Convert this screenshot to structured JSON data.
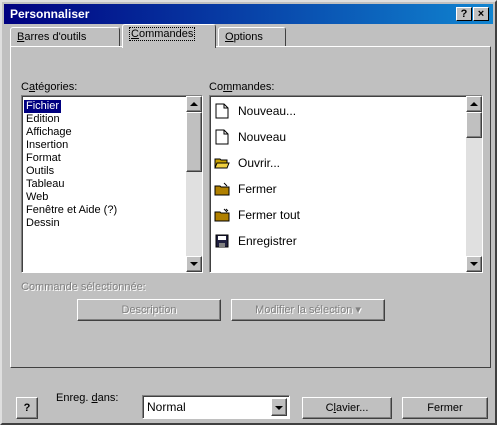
{
  "window": {
    "title": "Personnaliser",
    "help_glyph": "?",
    "close_glyph": "×"
  },
  "tabs": [
    {
      "pre": "",
      "key": "B",
      "post": "arres d'outils"
    },
    {
      "pre": "",
      "key": "C",
      "post": "ommandes"
    },
    {
      "pre": "",
      "key": "O",
      "post": "ptions"
    }
  ],
  "categories": {
    "label_pre": "C",
    "label_key": "a",
    "label_post": "tégories:",
    "items": [
      "Fichier",
      "Edition",
      "Affichage",
      "Insertion",
      "Format",
      "Outils",
      "Tableau",
      "Web",
      "Fenêtre et Aide (?)",
      "Dessin"
    ],
    "selected_index": 0
  },
  "commands": {
    "label_pre": "Co",
    "label_key": "m",
    "label_post": "mandes:",
    "items": [
      {
        "label": "Nouveau...",
        "icon": "new-document-icon"
      },
      {
        "label": "Nouveau",
        "icon": "new-document-icon"
      },
      {
        "label": "Ouvrir...",
        "icon": "open-folder-icon"
      },
      {
        "label": "Fermer",
        "icon": "close-file-icon"
      },
      {
        "label": "Fermer tout",
        "icon": "close-all-icon"
      },
      {
        "label": "Enregistrer",
        "icon": "save-disk-icon"
      }
    ]
  },
  "selected_command": {
    "label": "Commande sélectionnée:",
    "description_button": "Description",
    "modify_button": "Modifier la sélection ▾"
  },
  "footer": {
    "help_glyph": "?",
    "save_in_pre": "Enreg. ",
    "save_in_key": "d",
    "save_in_post": "ans:",
    "save_in_value": "Normal",
    "keyboard_pre": "C",
    "keyboard_key": "l",
    "keyboard_post": "avier...",
    "close_button": "Fermer"
  },
  "colors": {
    "title_bar": "#000080",
    "selection": "#000080",
    "face": "#c0c0c0"
  }
}
